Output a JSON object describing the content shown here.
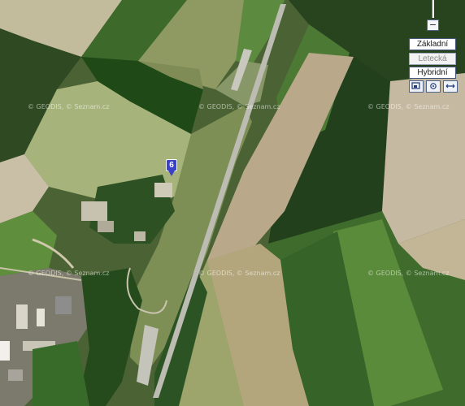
{
  "map": {
    "marker": {
      "label": "6"
    },
    "watermarks": [
      "© GEODIS, © Seznam.cz",
      "© GEODIS, © Seznam.cz",
      "© GEODIS, © Seznam.cz",
      "© GEODIS, © Seznam.cz",
      "© GEODIS, © Seznam.cz",
      "© GEODIS, © Seznam.cz"
    ]
  },
  "controls": {
    "zoom_out_label": "−",
    "map_types": [
      {
        "label": "Základní",
        "state": "normal"
      },
      {
        "label": "Letecká",
        "state": "dim"
      },
      {
        "label": "Hybridní",
        "state": "active"
      }
    ],
    "icons": [
      "fullscreen-icon",
      "center-icon",
      "expand-icon"
    ]
  }
}
